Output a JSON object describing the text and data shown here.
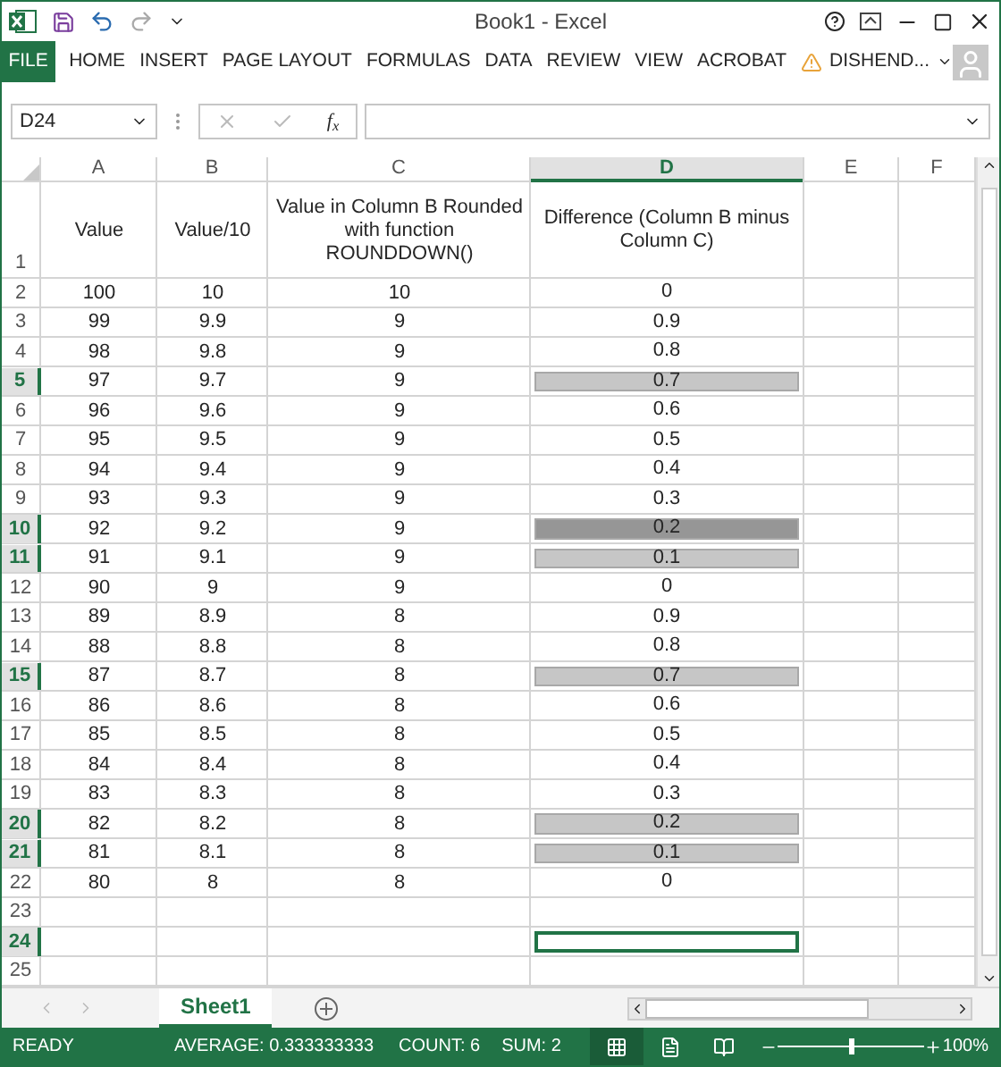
{
  "window": {
    "title": "Book1 - Excel"
  },
  "ribbon_tabs": [
    {
      "label": "FILE",
      "kind": "file"
    },
    {
      "label": "HOME",
      "kind": "tab"
    },
    {
      "label": "INSERT",
      "kind": "tab"
    },
    {
      "label": "PAGE LAYOUT",
      "kind": "tab"
    },
    {
      "label": "FORMULAS",
      "kind": "tab"
    },
    {
      "label": "DATA",
      "kind": "tab"
    },
    {
      "label": "REVIEW",
      "kind": "tab"
    },
    {
      "label": "VIEW",
      "kind": "tab"
    },
    {
      "label": "ACROBAT",
      "kind": "tab"
    }
  ],
  "user": {
    "name": "DISHEND..."
  },
  "formula_bar": {
    "name_box": "D24",
    "fx": "f$_{x}$"
  },
  "columns": [
    {
      "label": "A",
      "selected": false
    },
    {
      "label": "B",
      "selected": false
    },
    {
      "label": "C",
      "selected": false
    },
    {
      "label": "D",
      "selected": true
    },
    {
      "label": "E",
      "selected": false
    },
    {
      "label": "F",
      "selected": false
    }
  ],
  "rows": [
    {
      "number": "1",
      "selected": false,
      "active": false,
      "cells": [
        "Value",
        "Value/10",
        "Value in Column B Rounded with function ROUNDDOWN()",
        "Difference (Column B minus Column C)"
      ]
    },
    {
      "number": "2",
      "selected": false,
      "active": false,
      "cells": [
        "100",
        "10",
        "10",
        "0"
      ]
    },
    {
      "number": "3",
      "selected": false,
      "active": false,
      "cells": [
        "99",
        "9.9",
        "9",
        "0.9"
      ]
    },
    {
      "number": "4",
      "selected": false,
      "active": false,
      "cells": [
        "98",
        "9.8",
        "9",
        "0.8"
      ]
    },
    {
      "number": "5",
      "selected": true,
      "active": false,
      "color": "#c6c6c6",
      "cells": [
        "97",
        "9.7",
        "9",
        "0.7"
      ]
    },
    {
      "number": "6",
      "selected": false,
      "active": false,
      "cells": [
        "96",
        "9.6",
        "9",
        "0.6"
      ]
    },
    {
      "number": "7",
      "selected": false,
      "active": false,
      "cells": [
        "95",
        "9.5",
        "9",
        "0.5"
      ]
    },
    {
      "number": "8",
      "selected": false,
      "active": false,
      "cells": [
        "94",
        "9.4",
        "9",
        "0.4"
      ]
    },
    {
      "number": "9",
      "selected": false,
      "active": false,
      "cells": [
        "93",
        "9.3",
        "9",
        "0.3"
      ]
    },
    {
      "number": "10",
      "selected": true,
      "active": false,
      "color": "#969696",
      "cells": [
        "92",
        "9.2",
        "9",
        "0.2"
      ]
    },
    {
      "number": "11",
      "selected": true,
      "active": false,
      "color": "#c6c6c6",
      "cells": [
        "91",
        "9.1",
        "9",
        "0.1"
      ]
    },
    {
      "number": "12",
      "selected": false,
      "active": false,
      "cells": [
        "90",
        "9",
        "9",
        "0"
      ]
    },
    {
      "number": "13",
      "selected": false,
      "active": false,
      "cells": [
        "89",
        "8.9",
        "8",
        "0.9"
      ]
    },
    {
      "number": "14",
      "selected": false,
      "active": false,
      "cells": [
        "88",
        "8.8",
        "8",
        "0.8"
      ]
    },
    {
      "number": "15",
      "selected": true,
      "active": false,
      "color": "#c6c6c6",
      "cells": [
        "87",
        "8.7",
        "8",
        "0.7"
      ]
    },
    {
      "number": "16",
      "selected": false,
      "active": false,
      "cells": [
        "86",
        "8.6",
        "8",
        "0.6"
      ]
    },
    {
      "number": "17",
      "selected": false,
      "active": false,
      "cells": [
        "85",
        "8.5",
        "8",
        "0.5"
      ]
    },
    {
      "number": "18",
      "selected": false,
      "active": false,
      "cells": [
        "84",
        "8.4",
        "8",
        "0.4"
      ]
    },
    {
      "number": "19",
      "selected": false,
      "active": false,
      "cells": [
        "83",
        "8.3",
        "8",
        "0.3"
      ]
    },
    {
      "number": "20",
      "selected": true,
      "active": false,
      "color": "#c6c6c6",
      "cells": [
        "82",
        "8.2",
        "8",
        "0.2"
      ]
    },
    {
      "number": "21",
      "selected": true,
      "active": false,
      "color": "#c6c6c6",
      "cells": [
        "81",
        "8.1",
        "8",
        "0.1"
      ]
    },
    {
      "number": "22",
      "selected": false,
      "active": false,
      "cells": [
        "80",
        "8",
        "8",
        "0"
      ]
    },
    {
      "number": "23",
      "selected": false,
      "active": false,
      "cells": []
    },
    {
      "number": "24",
      "selected": true,
      "active": true,
      "cells": []
    },
    {
      "number": "25",
      "selected": false,
      "active": false,
      "cells": []
    }
  ],
  "sheet_tabs": [
    {
      "label": "Sheet1",
      "selected": true
    }
  ],
  "status_bar": {
    "state": "READY",
    "average": "AVERAGE: 0.333333333",
    "count": "COUNT: 6",
    "sum": "SUM: 2",
    "zoom": "100%",
    "zoom_level": {
      "level": 0.5
    }
  }
}
